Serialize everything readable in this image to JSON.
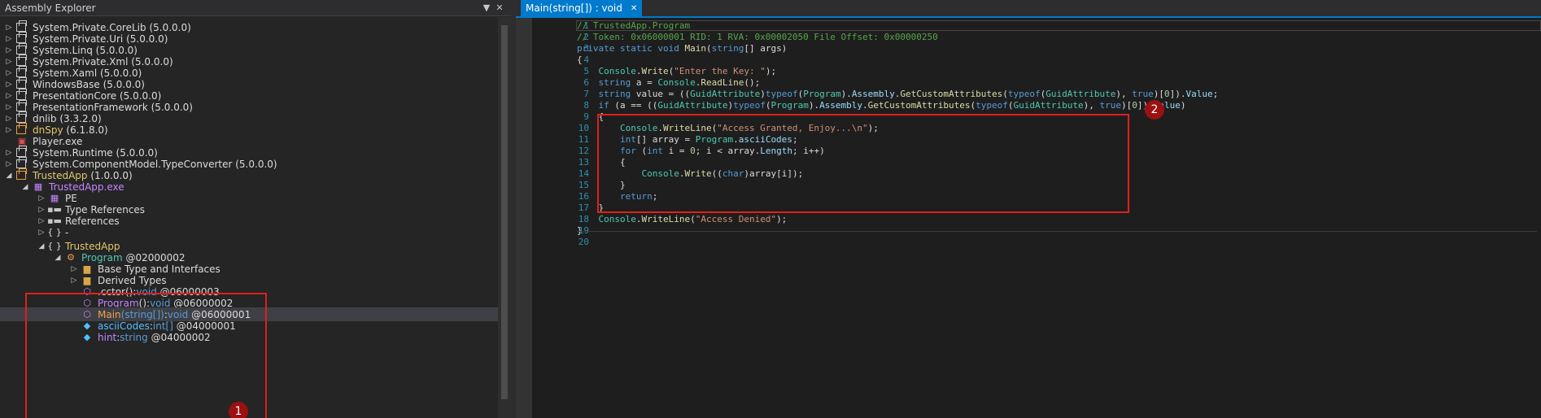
{
  "assembly_explorer": {
    "title": "Assembly Explorer",
    "dropdown_icon": "chevron-down-icon",
    "close_label": "✕",
    "items": [
      {
        "name": "System.Private.CoreLib",
        "version": "(5.0.0.0)"
      },
      {
        "name": "System.Private.Uri",
        "version": "(5.0.0.0)"
      },
      {
        "name": "System.Linq",
        "version": "(5.0.0.0)"
      },
      {
        "name": "System.Private.Xml",
        "version": "(5.0.0.0)"
      },
      {
        "name": "System.Xaml",
        "version": "(5.0.0.0)"
      },
      {
        "name": "WindowsBase",
        "version": "(5.0.0.0)"
      },
      {
        "name": "PresentationCore",
        "version": "(5.0.0.0)"
      },
      {
        "name": "PresentationFramework",
        "version": "(5.0.0.0)"
      },
      {
        "name": "dnlib",
        "version": "(3.3.2.0)"
      },
      {
        "name": "dnSpy",
        "version": "(6.1.8.0)"
      },
      {
        "name": "Player.exe",
        "version": ""
      },
      {
        "name": "System.Runtime",
        "version": "(5.0.0.0)"
      },
      {
        "name": "System.ComponentModel.TypeConverter",
        "version": "(5.0.0.0)"
      },
      {
        "name": "TrustedApp",
        "version": "(1.0.0.0)"
      }
    ],
    "trustedapp_exe": "TrustedApp.exe",
    "pe": "PE",
    "type_references": "Type References",
    "references": "References",
    "ns_dash": "-",
    "ns_trustedapp": "TrustedApp",
    "program": {
      "name": "Program",
      "token": "@02000002"
    },
    "base_types": "Base Type and Interfaces",
    "derived_types": "Derived Types",
    "members": [
      {
        "name": ".cctor",
        "params": "()",
        "sep": " : ",
        "type": "void",
        "token": "@06000003"
      },
      {
        "name": "Program",
        "params": "()",
        "sep": " : ",
        "type": "void",
        "token": "@06000002"
      },
      {
        "name": "Main",
        "params": "(string[])",
        "sep": " : ",
        "type": "void",
        "token": "@06000001"
      },
      {
        "name": "asciiCodes",
        "params": "",
        "sep": " : ",
        "type": "int[]",
        "token": "@04000001"
      },
      {
        "name": "hint",
        "params": "",
        "sep": " : ",
        "type": "string",
        "token": "@04000002"
      }
    ]
  },
  "editor": {
    "tab_label": "Main(string[]) : void",
    "tab_close": "✕",
    "lines": [
      "// TrustedApp.Program",
      "// Token: 0x06000001 RID: 1 RVA: 0x00002050 File Offset: 0x00000250",
      "private static void Main(string[] args)",
      "{",
      "    Console.Write(\"Enter the Key: \");",
      "    string a = Console.ReadLine();",
      "    string value = ((GuidAttribute)typeof(Program).Assembly.GetCustomAttributes(typeof(GuidAttribute), true)[0]).Value;",
      "    if (a == ((GuidAttribute)typeof(Program).Assembly.GetCustomAttributes(typeof(GuidAttribute), true)[0]).Value)",
      "    {",
      "        Console.WriteLine(\"Access Granted, Enjoy...\\n\");",
      "        int[] array = Program.asciiCodes;",
      "        for (int i = 0; i < array.Length; i++)",
      "        {",
      "            Console.Write((char)array[i]);",
      "        }",
      "        return;",
      "    }",
      "    Console.WriteLine(\"Access Denied\");",
      "}",
      ""
    ]
  },
  "annotations": {
    "badge1": "1",
    "badge2": "2"
  },
  "colors": {
    "accent": "#007acc",
    "highlight_box": "#e0201c",
    "badge": "#9b1010"
  }
}
